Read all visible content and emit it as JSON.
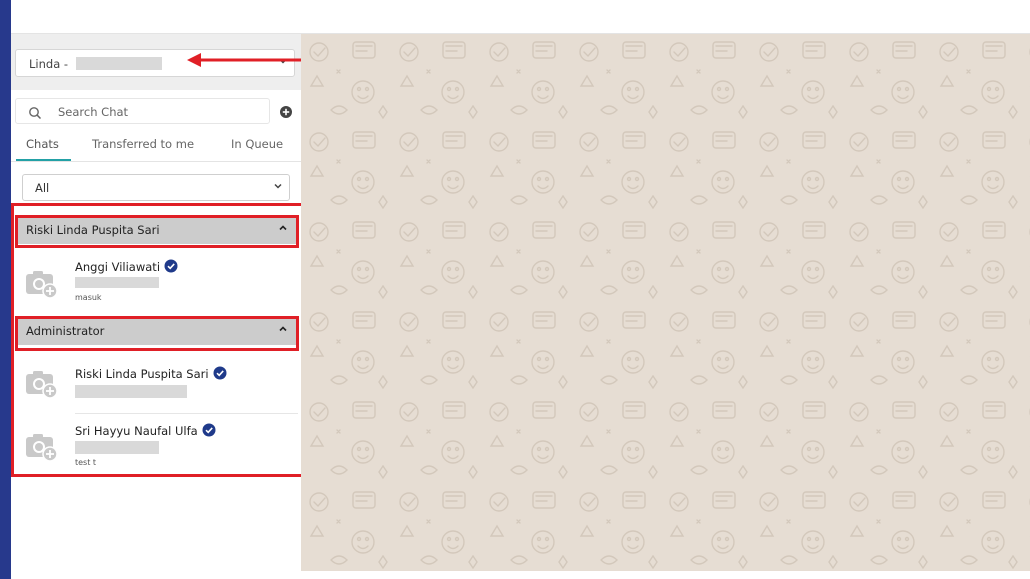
{
  "agent_select": {
    "value": "Linda - "
  },
  "search": {
    "placeholder": "Search Chat"
  },
  "tabs": [
    {
      "label": "Chats",
      "active": true
    },
    {
      "label": "Transferred to me",
      "active": false
    },
    {
      "label": "In Queue",
      "active": false
    }
  ],
  "filter": {
    "value": "All"
  },
  "groups": [
    {
      "title": "Riski Linda Puspita Sari",
      "chats": [
        {
          "name": "Anggi Viliawati",
          "verified": true,
          "last_message": "masuk"
        }
      ]
    },
    {
      "title": "Administrator",
      "chats": [
        {
          "name": "Riski Linda Puspita Sari",
          "verified": true,
          "last_message": ""
        },
        {
          "name": "Sri Hayyu Naufal Ulfa",
          "verified": true,
          "last_message": "test t"
        }
      ]
    }
  ],
  "icons": {
    "search": "search-icon",
    "add": "plus-circle-icon",
    "verified": "verified-badge-icon",
    "avatar": "camera-add-icon",
    "chevron": "chevron-down-icon",
    "collapse": "chevron-up-icon"
  },
  "colors": {
    "brand_strip": "#27398c",
    "tab_active": "#23a1a6",
    "group_header": "#cccccc",
    "verified": "#1f3a8a",
    "highlight": "#e01f26",
    "chat_background": "#e6ddd3"
  }
}
